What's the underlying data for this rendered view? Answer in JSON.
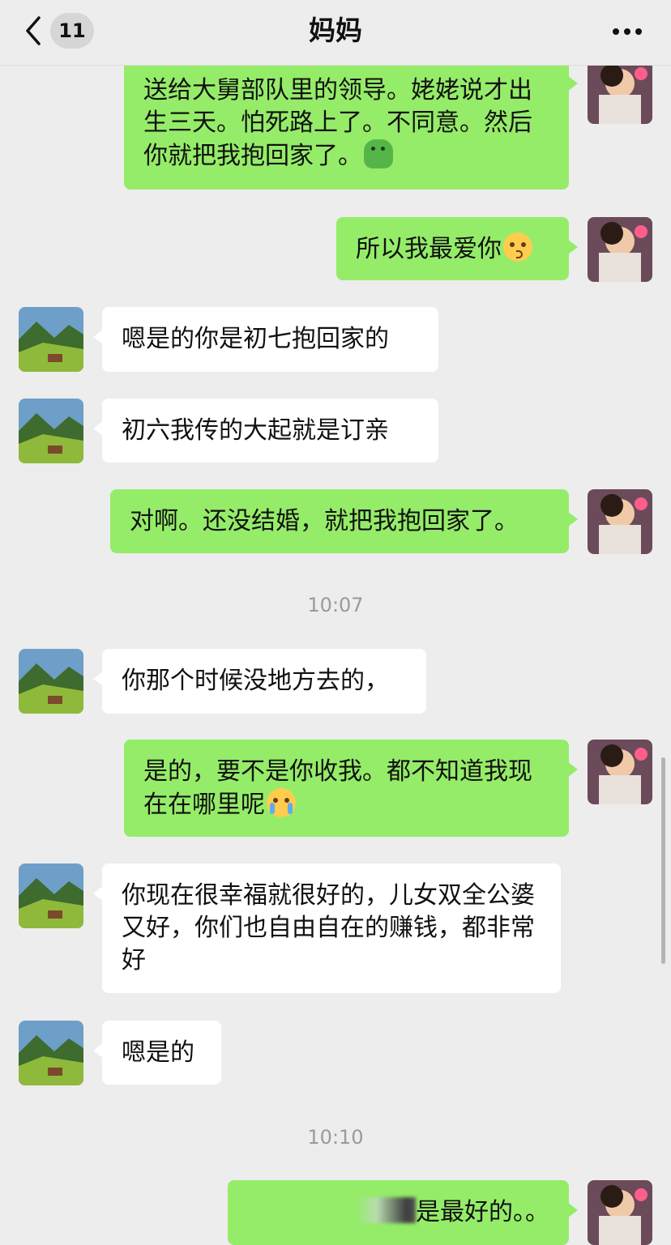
{
  "header": {
    "back_icon": "chevron-left-icon",
    "unread_count": "11",
    "title": "妈妈",
    "more_icon": "more-dots-icon"
  },
  "messages": [
    {
      "from": "me",
      "text": "送给大舅部队里的领导。姥姥说才出生三天。怕死路上了。不同意。然后你就把我抱回家了。",
      "emoji": "green-figure-emoji"
    },
    {
      "from": "me",
      "text": "所以我最爱你",
      "emoji": "kissing-face-emoji"
    },
    {
      "from": "them",
      "text": "嗯是的你是初七抱回家的"
    },
    {
      "from": "them",
      "text": "初六我传的大起就是订亲"
    },
    {
      "from": "me",
      "text": "对啊。还没结婚，就把我抱回家了。"
    },
    {
      "timestamp": "10:07"
    },
    {
      "from": "them",
      "text": "你那个时候没地方去的，"
    },
    {
      "from": "me",
      "text": "是的，要不是你收我。都不知道我现在在哪里呢",
      "emoji": "loudly-crying-face-emoji"
    },
    {
      "from": "them",
      "text": "你现在很幸福就很好的，儿女双全公婆又好，你们也自由自在的赚钱，都非常好"
    },
    {
      "from": "them",
      "text": "嗯是的"
    },
    {
      "timestamp": "10:10"
    },
    {
      "from": "me",
      "text": "是最好的。。",
      "redacted_prefix": true
    }
  ],
  "colors": {
    "background": "#ededed",
    "my_bubble": "#95ec69",
    "their_bubble": "#ffffff",
    "timestamp": "#9a9a9a"
  }
}
